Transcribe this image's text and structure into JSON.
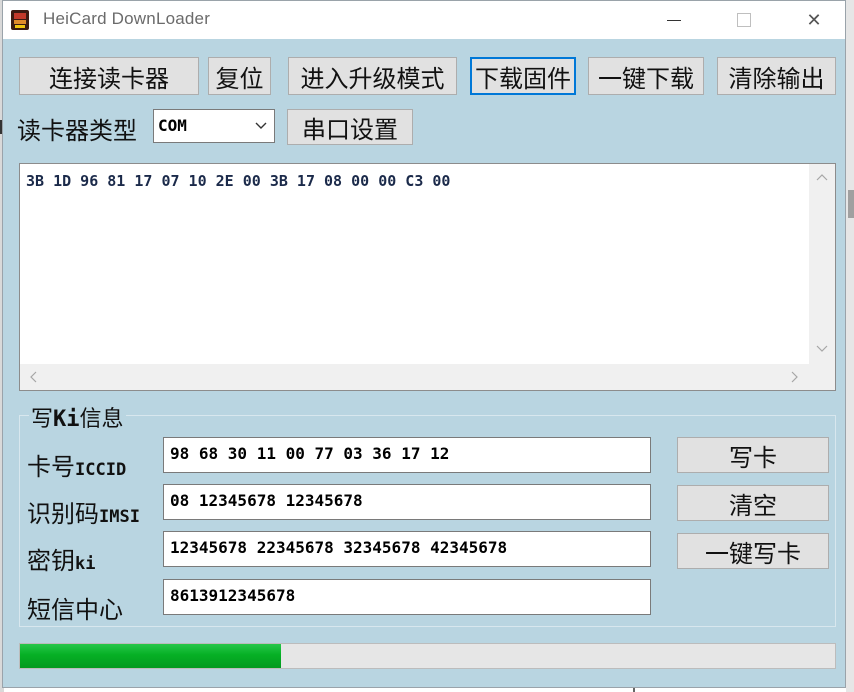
{
  "window": {
    "title": "HeiCard DownLoader",
    "minimize": "—",
    "close": "✕"
  },
  "toolbar": {
    "connect": "连接读卡器",
    "reset": "复位",
    "upgrade_mode": "进入升级模式",
    "download_firmware": "下载固件",
    "one_click_download": "一键下载",
    "clear_output": "清除输出"
  },
  "reader": {
    "type_label": "读卡器类型",
    "type_value": "COM",
    "serial_settings": "串口设置"
  },
  "output": {
    "text": "3B 1D 96 81 17 07 10 2E 00 3B 17 08 00 00 C3 00"
  },
  "write_ki": {
    "group_title_prefix": "写",
    "group_title_mono": "Ki",
    "group_title_suffix": "信息",
    "iccid_label_prefix": "卡号",
    "iccid_label_mono": "ICCID",
    "iccid_value": "98 68 30 11 00 77 03 36 17 12",
    "imsi_label_prefix": "识别码",
    "imsi_label_mono": "IMSI",
    "imsi_value": "08 12345678 12345678",
    "ki_label_prefix": "密钥",
    "ki_label_mono": "ki",
    "ki_value": "12345678 22345678 32345678 42345678",
    "smsc_label": "短信中心",
    "smsc_value": "8613912345678",
    "write_card": "写卡",
    "clear": "清空",
    "one_click_write": "一键写卡"
  },
  "progress": {
    "value": 0.32
  },
  "colors": {
    "window_bg": "#b9d5e1",
    "focus": "#0078d7",
    "progress": "#06b025"
  },
  "icons": [
    "app-icon",
    "minimize-icon",
    "maximize-icon",
    "close-icon",
    "dropdown-arrow-icon",
    "scroll-up-icon",
    "scroll-down-icon",
    "scroll-left-icon",
    "scroll-right-icon"
  ]
}
